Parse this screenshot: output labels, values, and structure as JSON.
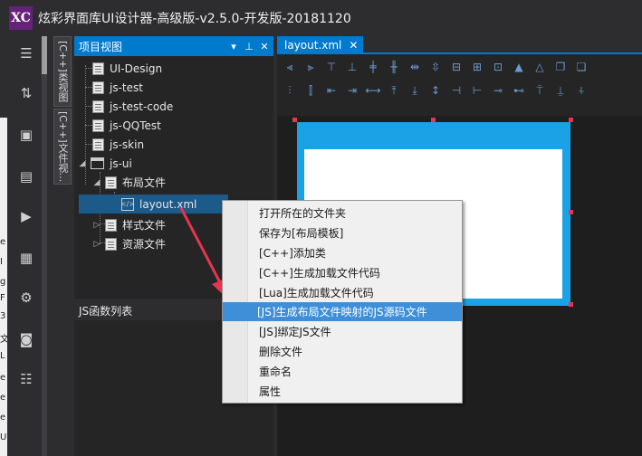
{
  "app": {
    "logo": "XC",
    "title": "炫彩界面库UI设计器-高级版-v2.5.0-开发版-20181120"
  },
  "background_window": {
    "edge_chars": [
      "e",
      "I",
      "g",
      "F",
      "3",
      "文",
      "L",
      "e",
      "e",
      "e",
      "U"
    ]
  },
  "activity_bar": {
    "items": [
      {
        "name": "menu-icon",
        "glyph": "☰"
      },
      {
        "name": "sort-icon",
        "glyph": "⇅"
      },
      {
        "name": "save-icon",
        "glyph": "▣"
      },
      {
        "name": "save-all-icon",
        "glyph": "▤"
      },
      {
        "name": "run-icon",
        "glyph": "▶"
      },
      {
        "name": "preview-icon",
        "glyph": "▦"
      },
      {
        "name": "settings-icon",
        "glyph": "⚙"
      },
      {
        "name": "database-icon",
        "glyph": "◙"
      },
      {
        "name": "document-icon",
        "glyph": "☷"
      }
    ]
  },
  "side_tabs": [
    {
      "label": "[C++]类视图"
    },
    {
      "label": "[C++]文件视..."
    }
  ],
  "project_view": {
    "title": "项目视图",
    "header_buttons": [
      "▾",
      "⊥",
      "✕"
    ],
    "tree": [
      {
        "label": "UI-Design",
        "type": "project"
      },
      {
        "label": "js-test",
        "type": "project"
      },
      {
        "label": "js-test-code",
        "type": "project"
      },
      {
        "label": "js-QQTest",
        "type": "project"
      },
      {
        "label": "js-skin",
        "type": "project"
      },
      {
        "label": "js-ui",
        "type": "project"
      },
      {
        "label": "布局文件",
        "type": "folder"
      },
      {
        "label": "layout.xml",
        "type": "xml"
      },
      {
        "label": "样式文件",
        "type": "folder"
      },
      {
        "label": "资源文件",
        "type": "folder"
      }
    ]
  },
  "js_panel": {
    "title": "JS函数列表"
  },
  "editor": {
    "tab_label": "layout.xml",
    "tab_close": "✕"
  },
  "context_menu": {
    "items": [
      "打开所在的文件夹",
      "保存为[布局模板]",
      "[C++]添加类",
      "[C++]生成加载文件代码",
      "[Lua]生成加载文件代码",
      "[JS]生成布局文件映射的JS源码文件",
      "[JS]绑定JS文件",
      "删除文件",
      "重命名",
      "属性"
    ],
    "highlighted": "[JS]生成布局文件映射的JS源码文件"
  },
  "colors": {
    "accent": "#007acc",
    "form_blue": "#1aa1e6",
    "handle_red": "#e8344f",
    "arrow_red": "#e8344f",
    "menu_highlight": "#3e8fd8"
  }
}
